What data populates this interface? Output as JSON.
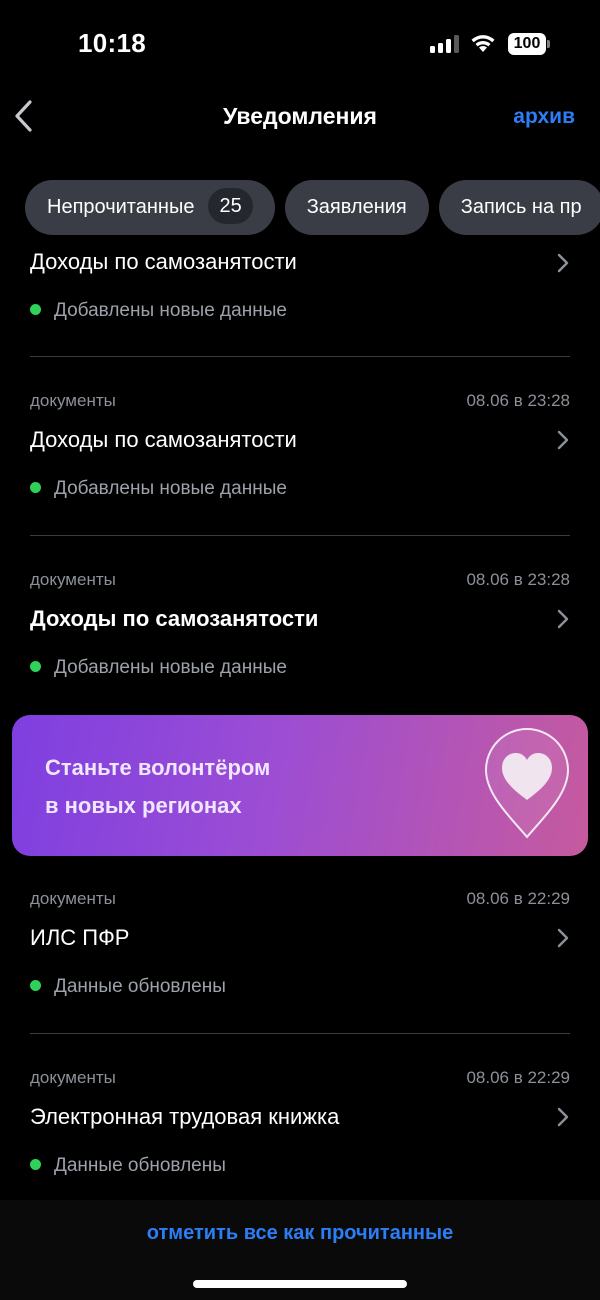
{
  "status_bar": {
    "time": "10:18",
    "battery": "100"
  },
  "nav": {
    "title": "Уведомления",
    "archive_label": "архив"
  },
  "chips": [
    {
      "label": "Непрочитанные",
      "count": "25"
    },
    {
      "label": "Заявления"
    },
    {
      "label": "Запись на пр"
    }
  ],
  "notifications": [
    {
      "category": "",
      "date": "",
      "title": "Доходы по самозанятости",
      "status": "Добавлены новые данные",
      "bold": false
    },
    {
      "category": "документы",
      "date": "08.06 в 23:28",
      "title": "Доходы по самозанятости",
      "status": "Добавлены новые данные",
      "bold": false
    },
    {
      "category": "документы",
      "date": "08.06 в 23:28",
      "title": "Доходы по самозанятости",
      "status": "Добавлены новые данные",
      "bold": true
    },
    {
      "category": "документы",
      "date": "08.06 в 22:29",
      "title": "ИЛС ПФР",
      "status": "Данные обновлены",
      "bold": false
    },
    {
      "category": "документы",
      "date": "08.06 в 22:29",
      "title": "Электронная трудовая книжка",
      "status": "Данные обновлены",
      "bold": false
    }
  ],
  "banner": {
    "line1": "Станьте волонтёром",
    "line2": "в новых регионах",
    "icon": "heart-pin-icon"
  },
  "footer": {
    "mark_all_label": "отметить все как прочитанные"
  },
  "colors": {
    "accent": "#2b7ef6",
    "status_dot": "#30d158",
    "chip_bg": "#3a3d45"
  }
}
